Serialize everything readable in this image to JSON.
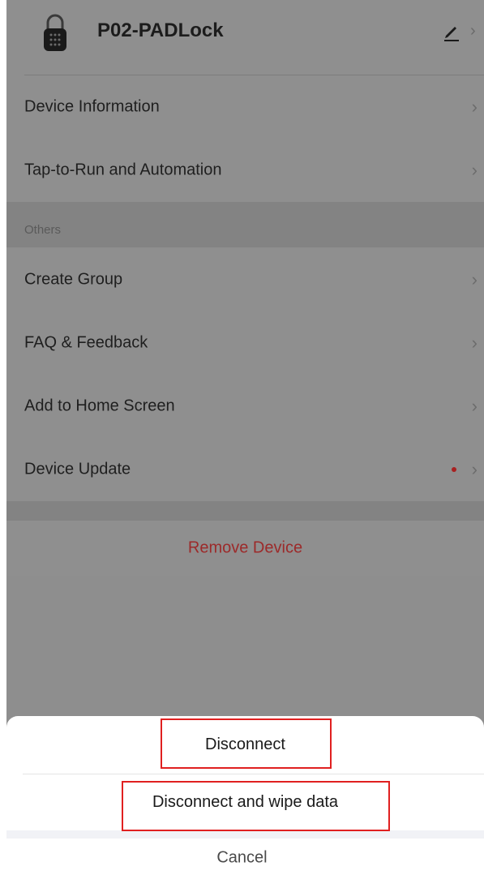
{
  "header": {
    "device_name": "P02-PADLock",
    "icons": {
      "device": "padlock-icon",
      "edit": "pencil-icon",
      "chevron": "chevron-right-icon"
    }
  },
  "menu_top": [
    {
      "label": "Device Information",
      "has_chevron": true
    },
    {
      "label": "Tap-to-Run and Automation",
      "has_chevron": true
    }
  ],
  "others_section": {
    "title": "Others",
    "items": [
      {
        "label": "Create Group",
        "has_chevron": true
      },
      {
        "label": "FAQ & Feedback",
        "has_chevron": true
      },
      {
        "label": "Add to Home Screen",
        "has_chevron": true
      },
      {
        "label": "Device Update",
        "has_chevron": true,
        "badge": "red-dot"
      }
    ]
  },
  "remove_device": {
    "label": "Remove Device",
    "color": "#c0392b"
  },
  "action_sheet": {
    "disconnect_label": "Disconnect",
    "disconnect_wipe_label": "Disconnect and wipe data",
    "cancel_label": "Cancel"
  },
  "colors": {
    "dim_background": "#8e8e8e",
    "highlight_border": "#e02020",
    "remove_text": "#9c2a2a"
  }
}
